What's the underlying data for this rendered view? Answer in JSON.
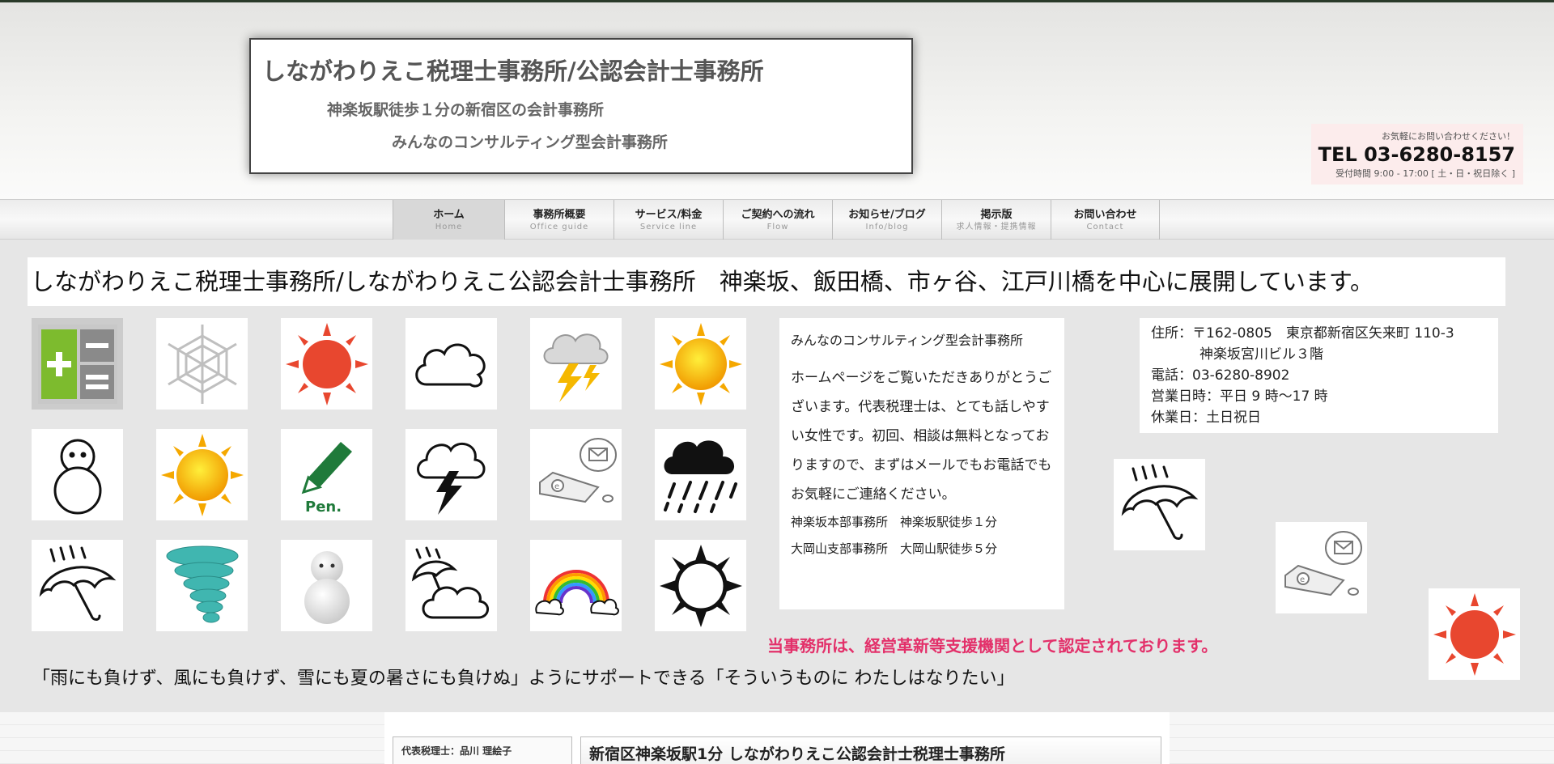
{
  "header": {
    "site_title": "しながわりえこ税理士事務所/公認会計士事務所",
    "tagline1": "神楽坂駅徒歩１分の新宿区の会計事務所",
    "tagline2": "みんなのコンサルティング型会計事務所"
  },
  "contact": {
    "lead": "お気軽にお問い合わせください！",
    "tel": "TEL 03-6280-8157",
    "hours": "受付時間 9:00 - 17:00 [ 土・日・祝日除く ]"
  },
  "nav": {
    "items": [
      {
        "jp": "ホーム",
        "en": "Home"
      },
      {
        "jp": "事務所概要",
        "en": "Office guide"
      },
      {
        "jp": "サービス/料金",
        "en": "Service line"
      },
      {
        "jp": "ご契約への流れ",
        "en": "Flow"
      },
      {
        "jp": "お知らせ/ブログ",
        "en": "Info/blog"
      },
      {
        "jp": "掲示版",
        "en": "求人情報・提携情報"
      },
      {
        "jp": "お問い合わせ",
        "en": "Contact"
      }
    ]
  },
  "banner": {
    "text": "しながわりえこ税理士事務所/しながわりえこ公認会計士事務所　神楽坂、飯田橋、市ヶ谷、江戸川橋を中心に展開しています。"
  },
  "icons": {
    "grid": [
      "calculator-icon",
      "snowflake-icon",
      "red-sun-icon",
      "cloud-icon",
      "thunder-cloud-icon",
      "sun-icon",
      "snowman-outline-icon",
      "sun-icon",
      "pen-icon",
      "thunderstorm-icon",
      "computer-mail-icon",
      "heavy-rain-icon",
      "umbrella-rain-icon",
      "tornado-icon",
      "snowman-icon",
      "rain-cloud-icon",
      "rainbow-icon",
      "black-sun-icon"
    ],
    "extra": [
      "umbrella-rain-icon",
      "computer-mail-icon",
      "red-sun-icon"
    ],
    "pen_label": "Pen.",
    "computer_letter": "e"
  },
  "greeting": {
    "title": "みんなのコンサルティング型会計事務所",
    "body": "ホームページをご覧いただきありがとうございます。代表税理士は、とても話しやすい女性です。初回、相談は無料となっておりますので、まずはメールでもお電話でもお気軽にご連絡ください。",
    "office1": "神楽坂本部事務所　神楽坂駅徒歩１分",
    "office2": "大岡山支部事務所　大岡山駅徒歩５分"
  },
  "address": {
    "line1": "住所：〒162-0805　東京都新宿区矢来町 110-3",
    "line2": "神楽坂宮川ビル３階",
    "line3": "電話：03-6280-8902",
    "line4": "営業日時：平日 9 時〜17 時",
    "line5": "休業日：土日祝日"
  },
  "certified": "当事務所は、経営革新等支援機関として認定されております。",
  "quote": "「雨にも負けず、風にも負けず、雪にも夏の暑さにも負けぬ」ようにサポートできる「そういうものに わたしはなりたい」",
  "footer": {
    "side_title": "代表税理士：品川 理絵子",
    "main_title": "新宿区神楽坂駅1分 しながわりえこ公認会計士税理士事務所"
  },
  "colors": {
    "accent_pink": "#e3306a",
    "contact_bg": "#fcecec",
    "calculator_green": "#7dbb2e",
    "red_sun": "#e8472f",
    "tornado_teal": "#40b6b0"
  }
}
